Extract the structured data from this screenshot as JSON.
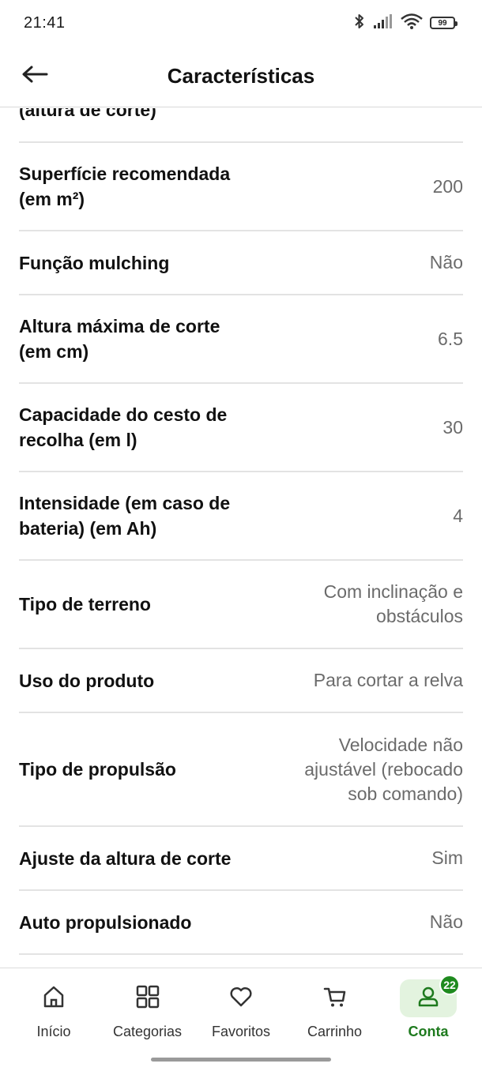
{
  "status_bar": {
    "time": "21:41",
    "battery": "99",
    "icons": [
      "bluetooth-icon",
      "signal-icon",
      "wifi-icon",
      "battery-icon"
    ]
  },
  "header": {
    "title": "Características",
    "back_icon": "arrow-left-icon"
  },
  "specs": {
    "partial_label": "(altura de corte)",
    "rows": [
      {
        "label": "Superfície recomendada (em m²)",
        "value": "200"
      },
      {
        "label": "Função mulching",
        "value": "Não"
      },
      {
        "label": "Altura máxima de corte (em cm)",
        "value": "6.5"
      },
      {
        "label": "Capacidade do cesto de recolha (em l)",
        "value": "30"
      },
      {
        "label": "Intensidade (em caso de bateria) (em Ah)",
        "value": "4"
      },
      {
        "label": "Tipo de terreno",
        "value": "Com inclinação e obstáculos"
      },
      {
        "label": "Uso do produto",
        "value": "Para cortar a relva"
      },
      {
        "label": "Tipo de propulsão",
        "value": "Velocidade não ajustável (rebocado sob comando)"
      },
      {
        "label": "Ajuste da altura de corte",
        "value": "Sim"
      },
      {
        "label": "Auto propulsionado",
        "value": "Não"
      }
    ]
  },
  "bottom_nav": {
    "items": [
      {
        "label": "Início",
        "icon": "home-icon",
        "active": false
      },
      {
        "label": "Categorias",
        "icon": "grid-icon",
        "active": false
      },
      {
        "label": "Favoritos",
        "icon": "heart-icon",
        "active": false
      },
      {
        "label": "Carrinho",
        "icon": "cart-icon",
        "active": false
      },
      {
        "label": "Conta",
        "icon": "user-icon",
        "active": true,
        "badge": "22"
      }
    ]
  },
  "colors": {
    "accent": "#1e7a1e",
    "accent_light": "#e3f3df",
    "divider": "#e3e3e3",
    "value_text": "#6b6b6b"
  }
}
